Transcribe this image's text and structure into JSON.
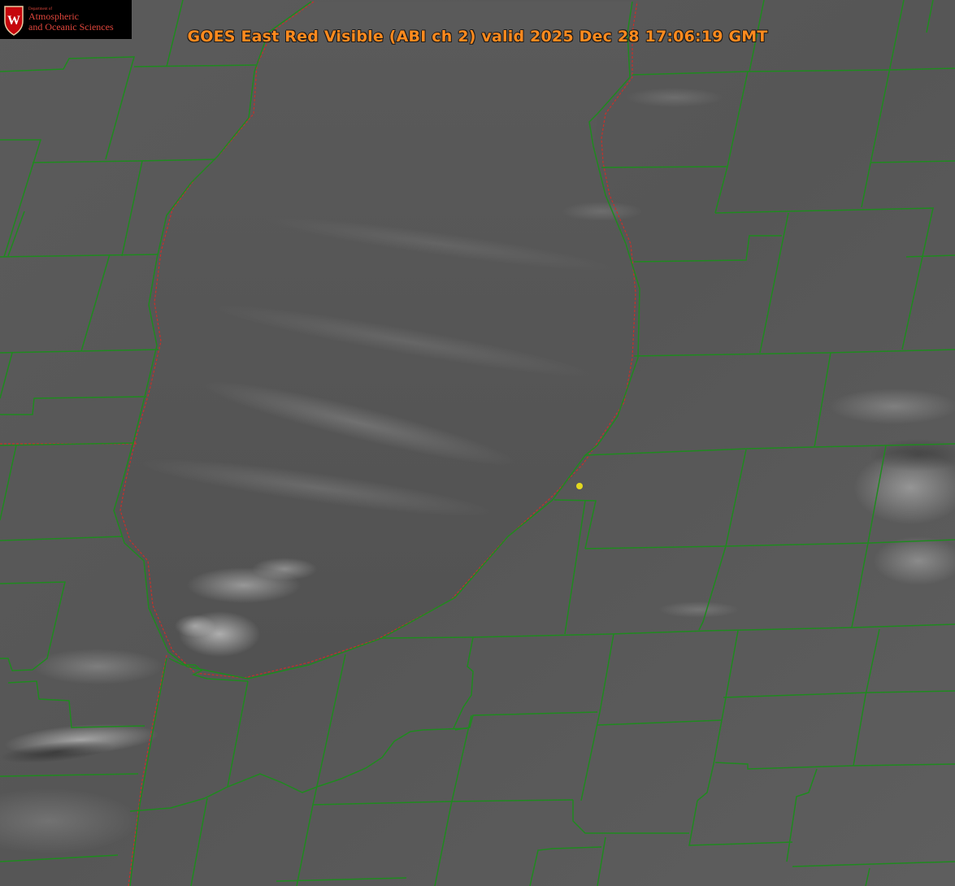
{
  "title": "GOES East Red Visible (ABI ch 2) valid 2025 Dec 28 17:06:19 GMT",
  "logo": {
    "crest_letter": "W",
    "department": "Department of",
    "line1": "Atmospheric",
    "line2": "and Oceanic Sciences"
  },
  "colors": {
    "county_border": "#1f8a1f",
    "state_border": "#c8302a",
    "marker": "#e3d81e",
    "title_text": "#ff8a1e",
    "logo_text": "#e0463c"
  },
  "marker": {
    "label": "",
    "icon": "location-dot-icon"
  }
}
